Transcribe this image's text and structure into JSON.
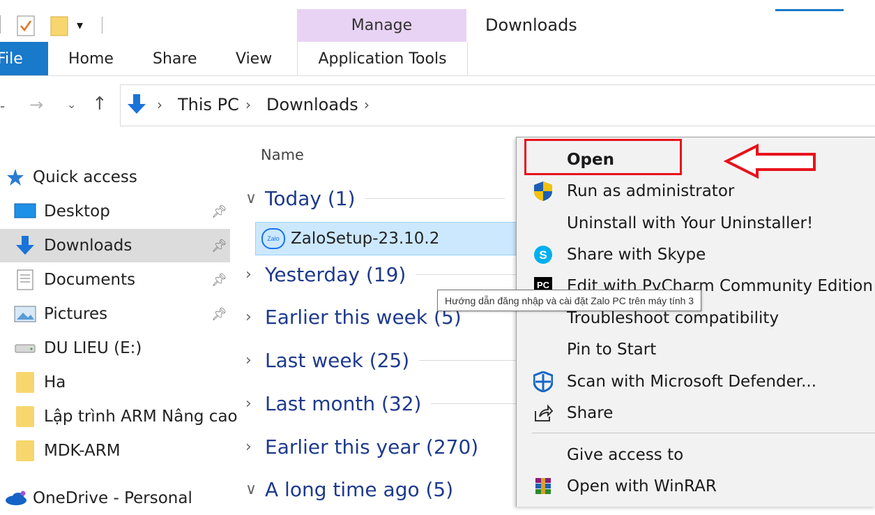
{
  "window_title": "Downloads",
  "ribbon": {
    "contextual_group": "Manage",
    "tabs": [
      "File",
      "Home",
      "Share",
      "View"
    ],
    "contextual_tab": "Application Tools"
  },
  "breadcrumb": [
    "This PC",
    "Downloads"
  ],
  "navigation": {
    "quick_access": "Quick access",
    "items": [
      {
        "label": "Desktop",
        "pinned": true,
        "icon": "desktop-icon"
      },
      {
        "label": "Downloads",
        "pinned": true,
        "icon": "download-arrow-icon",
        "selected": true
      },
      {
        "label": "Documents",
        "pinned": true,
        "icon": "documents-icon"
      },
      {
        "label": "Pictures",
        "pinned": true,
        "icon": "pictures-icon"
      },
      {
        "label": "DU LIEU (E:)",
        "pinned": false,
        "icon": "drive-icon"
      },
      {
        "label": "Ha",
        "pinned": false,
        "icon": "folder-icon"
      },
      {
        "label": "Lập trình ARM Nâng cao",
        "pinned": false,
        "icon": "folder-icon"
      },
      {
        "label": "MDK-ARM",
        "pinned": false,
        "icon": "folder-icon"
      }
    ],
    "onedrive": "OneDrive - Personal"
  },
  "file_list": {
    "column_name": "Name",
    "groups": [
      {
        "label": "Today (1)",
        "expanded": true
      },
      {
        "label": "Yesterday (19)",
        "expanded": false
      },
      {
        "label": "Earlier this week (5)",
        "expanded": false
      },
      {
        "label": "Last week (25)",
        "expanded": false
      },
      {
        "label": "Last month (32)",
        "expanded": false
      },
      {
        "label": "Earlier this year (270)",
        "expanded": false
      },
      {
        "label": "A long time ago (5)",
        "expanded": true
      }
    ],
    "selected_file": "ZaloSetup-23.10.2",
    "file_icon_text": "Zalo"
  },
  "tooltip": "Hướng dẫn đăng nhập và cài đặt Zalo PC trên máy tính 3",
  "context_menu": {
    "items": [
      {
        "label": "Open",
        "bold": true
      },
      {
        "label": "Run as administrator",
        "icon": "uac-shield-icon"
      },
      {
        "label": "Uninstall with Your Uninstaller!"
      },
      {
        "label": "Share with Skype",
        "icon": "skype-icon"
      },
      {
        "label": "Edit with PyCharm Community Edition",
        "icon": "pycharm-icon"
      },
      {
        "label": "Troubleshoot compatibility"
      },
      {
        "label": "Pin to Start"
      },
      {
        "label": "Scan with Microsoft Defender...",
        "icon": "defender-icon"
      },
      {
        "label": "Share",
        "icon": "share-icon"
      },
      {
        "label": "Give access to"
      },
      {
        "label": "Open with WinRAR",
        "icon": "winrar-icon"
      }
    ]
  },
  "colors": {
    "accent": "#1979ca",
    "manage_bg": "#e9d3f5",
    "selection": "#cce8ff",
    "highlight_red": "#e8121b"
  }
}
